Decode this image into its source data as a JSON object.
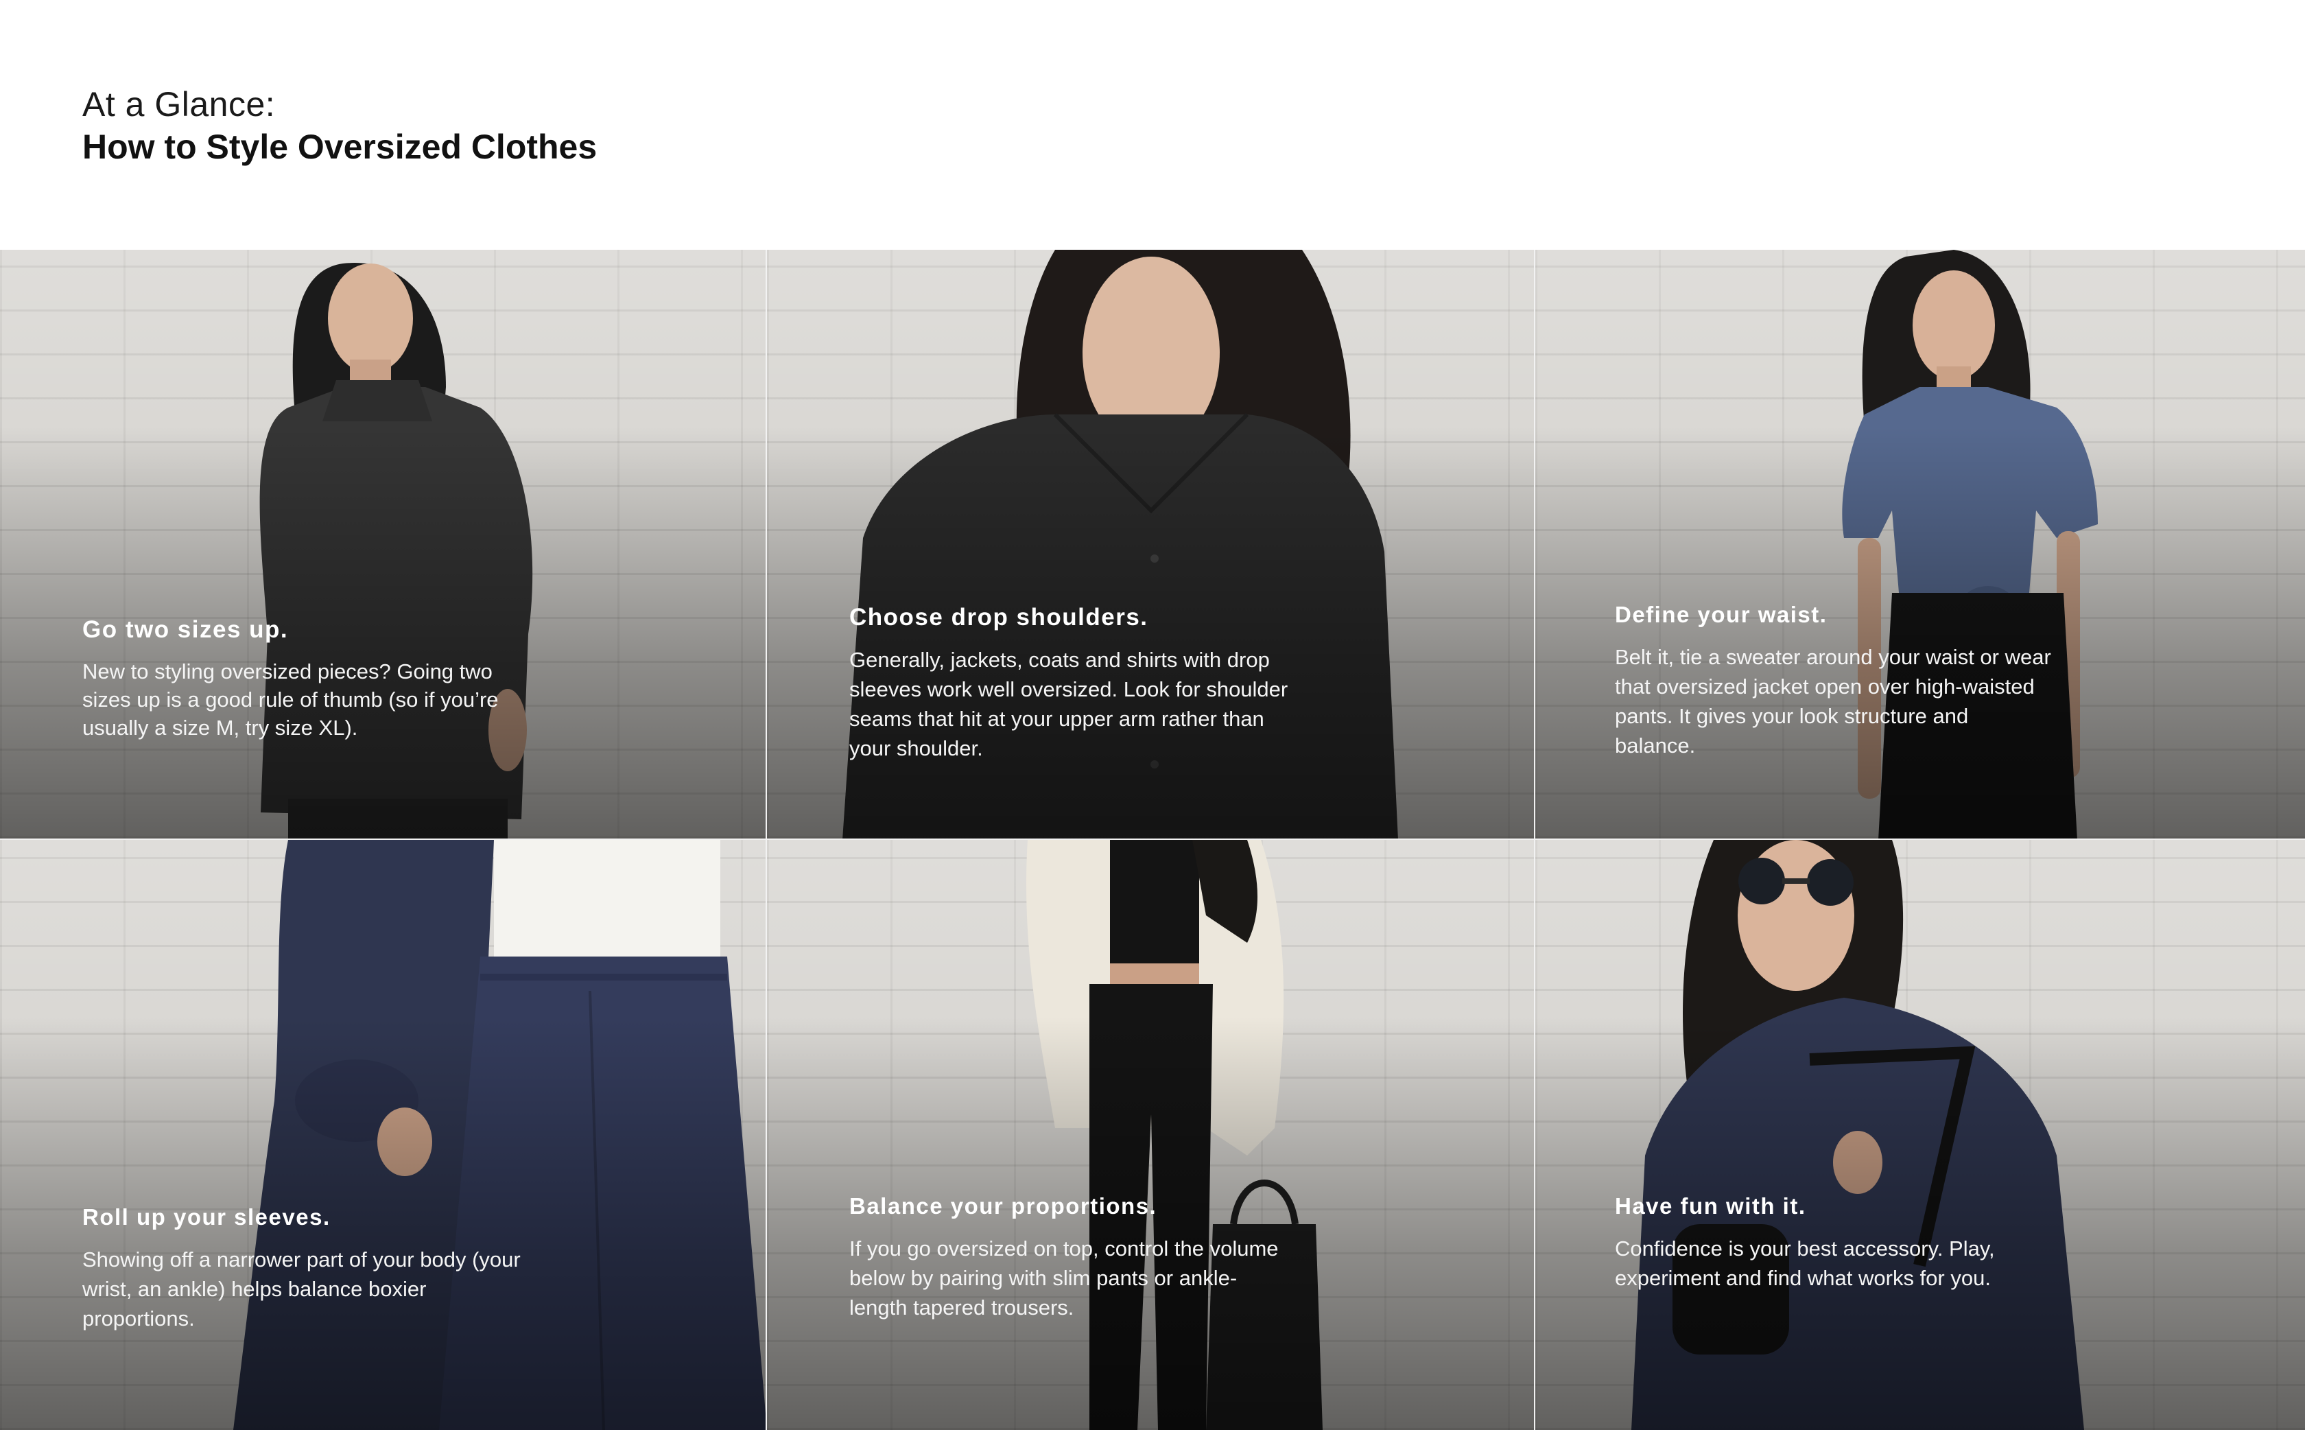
{
  "header": {
    "eyebrow": "At a Glance:",
    "title": "How to Style Oversized Clothes"
  },
  "tips": [
    {
      "title": "Go two sizes up.",
      "body": "New to styling oversized pieces? Going two sizes up is a good rule of thumb (so if you’re usually a size M, try size XL).",
      "photo": "woman in oversized charcoal turtleneck sweater"
    },
    {
      "title": "Choose drop shoulders.",
      "body": "Generally, jackets, coats and shirts with drop sleeves work well oversized. Look for shoulder seams that hit at your upper arm rather than your shoulder.",
      "photo": "woman in oversized black button-up shirt"
    },
    {
      "title": "Define your waist.",
      "body": "Belt it, tie a sweater around your waist or wear that oversized jacket open over high-waisted pants. It gives your look structure and balance.",
      "photo": "woman in knotted blue t-shirt and black skirt"
    },
    {
      "title": "Roll up your sleeves.",
      "body": "Showing off a narrower part of your body (your wrist, an ankle) helps balance boxier proportions.",
      "photo": "navy jacket with rolled sleeves and navy trousers"
    },
    {
      "title": "Balance your proportions.",
      "body": "If you go oversized on top, control the volume below by pairing with slim pants or ankle-length tapered trousers.",
      "photo": "cream oversized shirt over black leggings with tote bag"
    },
    {
      "title": "Have fun with it.",
      "body": "Confidence is your best accessory. Play, experiment and find what works for you.",
      "photo": "woman in sunglasses and navy oversized coat"
    }
  ],
  "colors": {
    "wall": "#d8d6d2",
    "charcoal": "#2b2b2b",
    "navy": "#2f3650",
    "denim": "#56698f",
    "cream": "#ece7dc",
    "text_on_photo": "#ffffff"
  }
}
